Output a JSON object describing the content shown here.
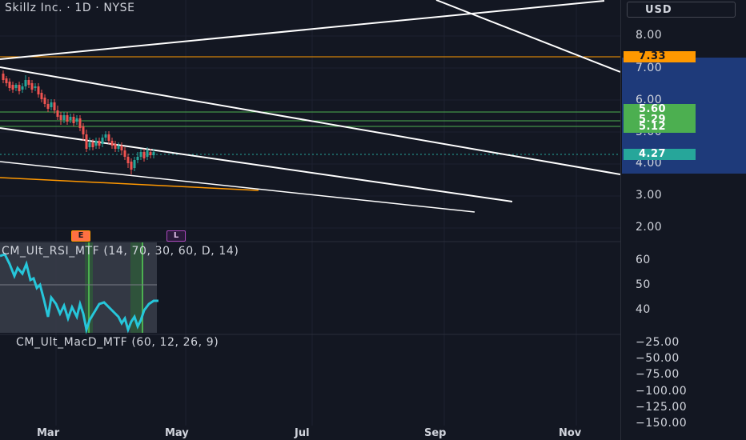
{
  "header": {
    "symbol_title": "Skillz Inc. · 1D · NYSE"
  },
  "price_axis": {
    "currency": "USD",
    "labels": [
      "8.00",
      "7.00",
      "6.00",
      "5.00",
      "4.00",
      "3.00",
      "2.00"
    ],
    "badges": [
      {
        "value": "7.33",
        "color": "#ff9800"
      },
      {
        "value": "5.60",
        "color": "#4caf50"
      },
      {
        "value": "5.29",
        "color": "#4caf50"
      },
      {
        "value": "5.12",
        "color": "#4caf50"
      },
      {
        "value": "4.27",
        "color": "#26a69a"
      }
    ]
  },
  "rsi_pane": {
    "legend": "CM_Ult_RSI_MTF (14, 70, 30, 60, D, 14)",
    "labels": [
      "60",
      "50",
      "40"
    ],
    "line_color": "#26c6da"
  },
  "macd_pane": {
    "legend": "CM_Ult_MacD_MTF (60, 12, 26, 9)",
    "labels": [
      "−25.00",
      "−50.00",
      "−75.00",
      "−100.00",
      "−125.00",
      "−150.00"
    ]
  },
  "time_axis": {
    "labels": [
      "Mar",
      "May",
      "Jul",
      "Sep",
      "Nov"
    ]
  },
  "events": {
    "earnings_marker": "E",
    "other_marker": "L"
  },
  "colors": {
    "background": "#131722",
    "trendline": "#ffffff",
    "support_orange": "#ff9800",
    "support_green": "#4caf50",
    "candle_up": "#26a69a",
    "candle_down": "#ef5350"
  }
}
